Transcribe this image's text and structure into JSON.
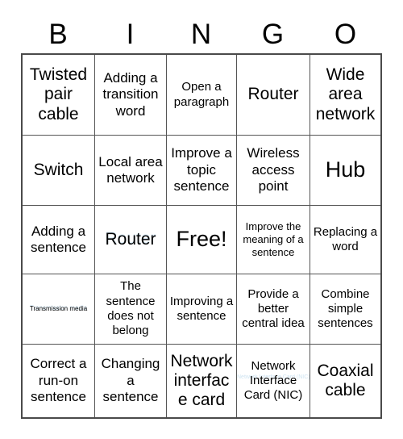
{
  "card": {
    "header_letters": [
      "B",
      "I",
      "N",
      "G",
      "O"
    ],
    "free_space_label": "Free!",
    "ghost_color": "#cfe4f2",
    "grid_line_color": "#555555",
    "rows": [
      [
        "Twisted pair cable",
        "Adding a transition word",
        "Open a paragraph",
        "Router",
        "Wide area network"
      ],
      [
        "Switch",
        "Local area network",
        "Improve a topic sentence",
        "Wireless access point",
        "Hub"
      ],
      [
        "Adding a sentence",
        "Router",
        "Free!",
        "Improve the meaning of a sentence",
        "Replacing a word"
      ],
      [
        "Transmission media",
        "The sentence does not belong",
        "Improving a sentence",
        "Provide a better central idea",
        "Combine simple sentences"
      ],
      [
        "Correct a run-on sentence",
        "Changing a sentence",
        "Network interface card",
        "Network Interface Card (NIC)",
        "Coaxial cable"
      ]
    ],
    "ghost_texts": {
      "router_cell": "Router",
      "transmission_cell": "Transmission media",
      "nic_cell": "Network Interface Card (NIC)"
    }
  }
}
